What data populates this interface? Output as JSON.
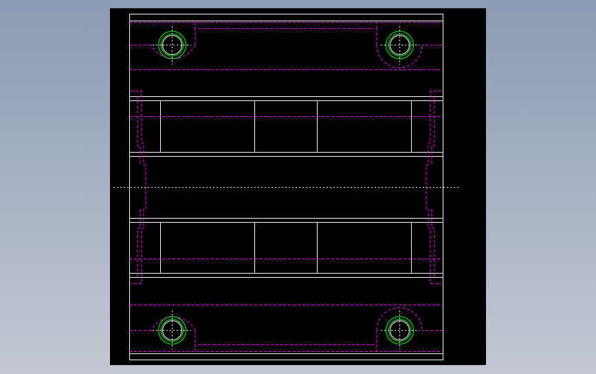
{
  "viewport": {
    "background": "#000000",
    "colors": {
      "outline": "#ffffff",
      "hidden_line": "#ff00ff",
      "hole": "#00ff00",
      "centerline": "#ffffff"
    }
  },
  "drawing": {
    "holes": [
      {
        "name": "bolt-hole-top-left"
      },
      {
        "name": "bolt-hole-top-right"
      },
      {
        "name": "bolt-hole-bottom-left"
      },
      {
        "name": "bolt-hole-bottom-right"
      }
    ],
    "slots": [
      {
        "name": "upper-slot"
      },
      {
        "name": "lower-slot"
      }
    ]
  }
}
